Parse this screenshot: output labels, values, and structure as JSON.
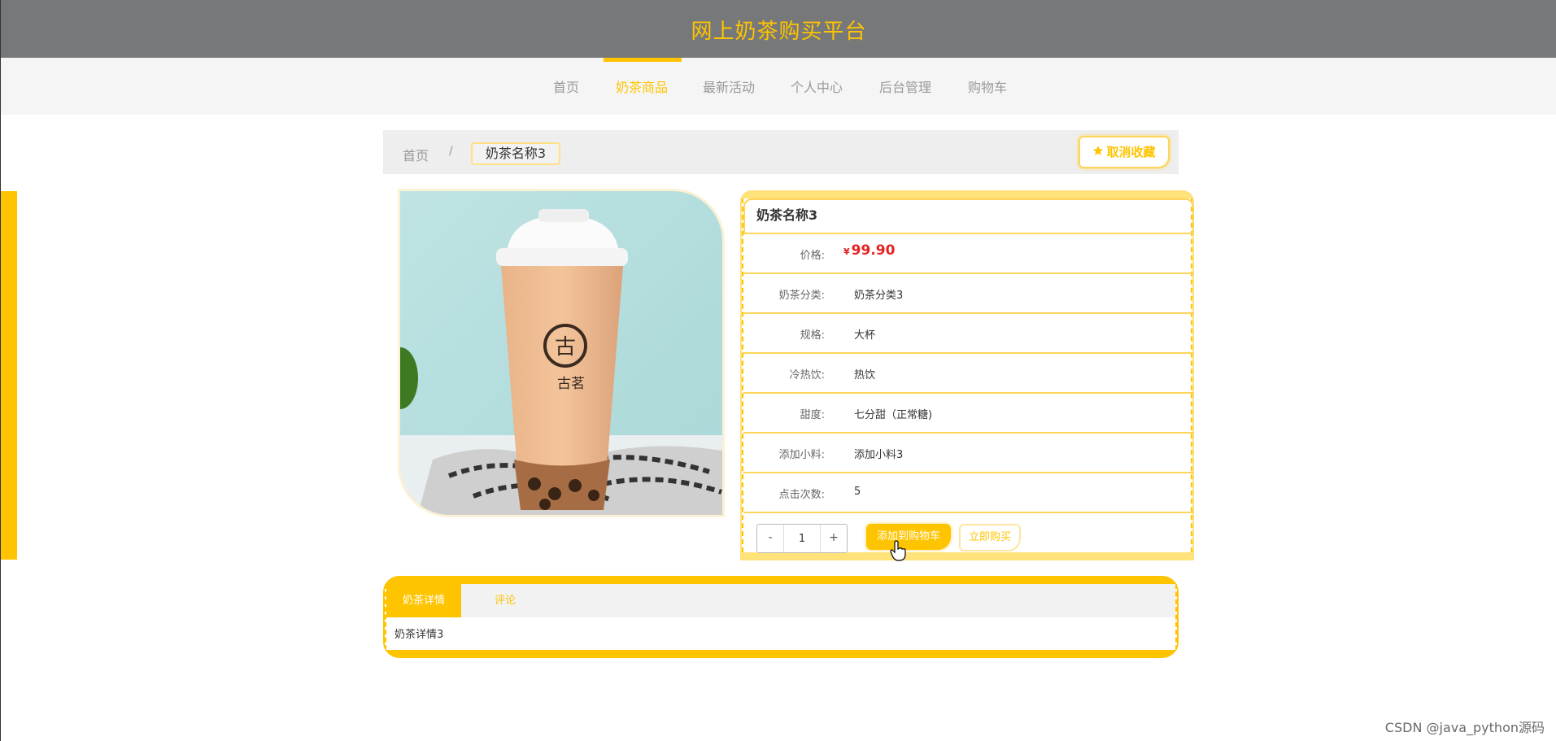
{
  "header": {
    "title": "网上奶茶购买平台"
  },
  "nav": {
    "items": [
      {
        "label": "首页"
      },
      {
        "label": "奶茶商品"
      },
      {
        "label": "最新活动"
      },
      {
        "label": "个人中心"
      },
      {
        "label": "后台管理"
      },
      {
        "label": "购物车"
      }
    ],
    "active": "奶茶商品"
  },
  "breadcrumb": {
    "home": "首页",
    "separator": "/",
    "current": "奶茶名称3"
  },
  "favorite_button": {
    "label": "取消收藏",
    "icon": "star-icon"
  },
  "product": {
    "name": "奶茶名称3",
    "price_label": "价格:",
    "currency": "¥",
    "price": "99.90",
    "fields": [
      {
        "label": "奶茶分类:",
        "value": "奶茶分类3"
      },
      {
        "label": "规格:",
        "value": "大杯"
      },
      {
        "label": "冷热饮:",
        "value": "热饮"
      },
      {
        "label": "甜度:",
        "value": "七分甜（正常糖)"
      },
      {
        "label": "添加小料:",
        "value": "添加小料3"
      },
      {
        "label": "点击次数:",
        "value": "5"
      }
    ],
    "image_text": "古茗"
  },
  "purchase": {
    "minus": "-",
    "plus": "+",
    "quantity": "1",
    "add_to_cart": "添加到购物车",
    "buy_now": "立即购买"
  },
  "tabs": {
    "items": [
      {
        "label": "奶茶详情"
      },
      {
        "label": "评论"
      }
    ],
    "active": "奶茶详情",
    "content": "奶茶详情3"
  },
  "watermark": "CSDN @java_python源码",
  "colors": {
    "accent": "#ffc400",
    "header_bg": "#77787a",
    "price": "#e52323"
  }
}
